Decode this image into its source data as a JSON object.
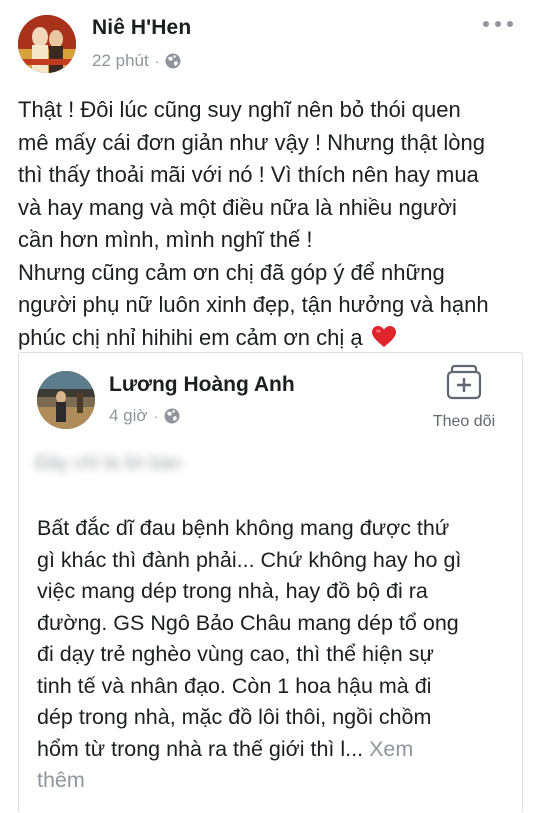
{
  "post": {
    "author": "Niê H'Hen",
    "time": "22 phút",
    "privacy_icon": "globe-icon",
    "more_icon": "more-horizontal-icon",
    "text_lines": [
      "Thật ! Đôi lúc cũng suy nghĩ nên bỏ thói quen",
      "mê mấy cái đơn giản như vậy ! Nhưng thật lòng",
      "thì thấy thoải mãi với nó ! Vì thích nên hay mua",
      "và hay mang và một điều nữa là nhiều người",
      "cần hơn mình, mình nghĩ thế !",
      "Nhưng cũng cảm ơn chị đã góp ý để những",
      "người phụ nữ luôn xinh đẹp, tận hưởng và hạnh",
      "phúc chị nhỉ hihihi em cảm ơn chị ạ"
    ],
    "emoji_icon": "red-heart-icon"
  },
  "shared_post": {
    "author": "Lương Hoàng Anh",
    "time": "4 giờ",
    "privacy_icon": "globe-icon",
    "follow_icon": "follow-box-plus-icon",
    "follow_label": "Theo dõi",
    "blurred_text": "Đây chỉ là lời bàn",
    "text_lines": [
      "Bất đắc dĩ đau bệnh không mang được thứ",
      "gì khác thì đành phải... Chứ không hay ho gì",
      "việc mang dép trong nhà, hay đồ bộ đi ra",
      "đường. GS Ngô Bảo Châu mang dép tổ ong",
      "đi dạy trẻ nghèo vùng cao, thì thể hiện sự",
      "tinh tế và nhân đạo. Còn 1 hoa hậu mà đi",
      "dép trong nhà, mặc đồ lôi thôi, ngồi chồm",
      "hổm từ trong nhà ra thế giới thì l..."
    ],
    "see_more_a": "Xem",
    "see_more_b": "thêm"
  },
  "colors": {
    "text": "#1c1e21",
    "meta": "#90949c",
    "heart": "#e0242b",
    "border": "#dddfe2"
  }
}
